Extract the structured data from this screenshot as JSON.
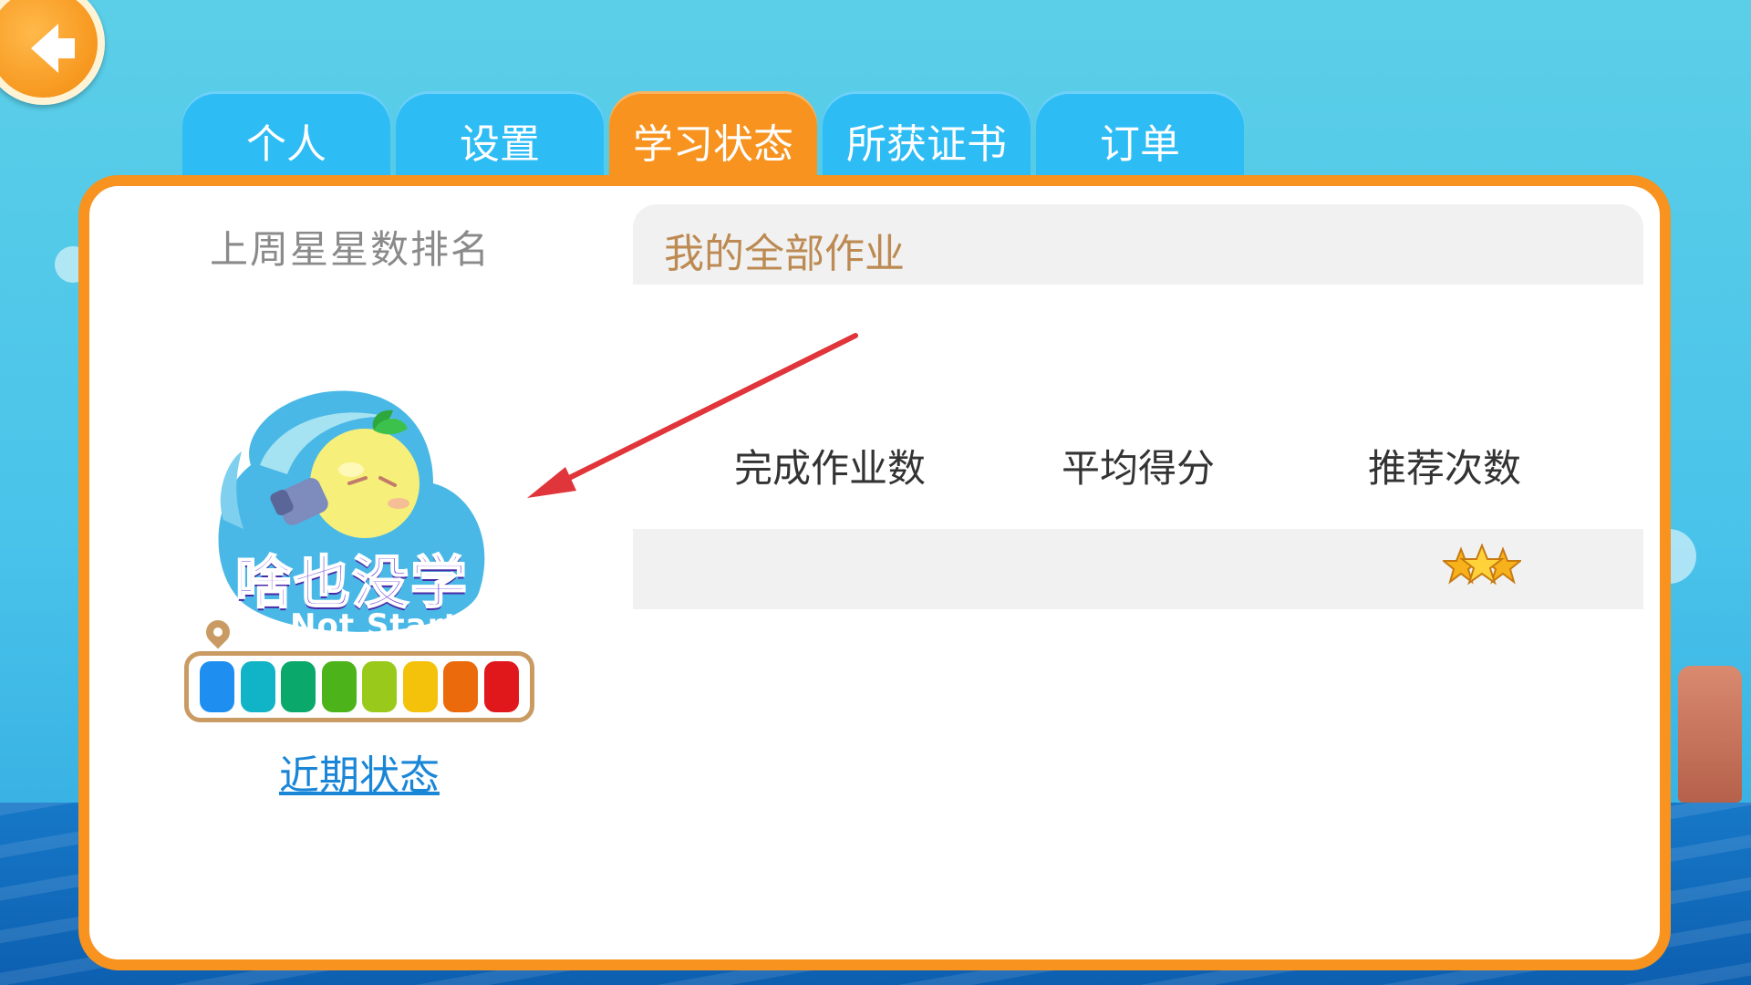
{
  "header": {
    "back_button": "back",
    "tabs": [
      {
        "label": "个人",
        "active": false
      },
      {
        "label": "设置",
        "active": false
      },
      {
        "label": "学习状态",
        "active": true
      },
      {
        "label": "所获证书",
        "active": false
      },
      {
        "label": "订单",
        "active": false
      }
    ]
  },
  "left": {
    "title": "上周星星数排名",
    "status_cn": "啥也没学",
    "status_en": "Not Start Yet",
    "meter_colors": [
      "#1e8ff0",
      "#11b4c6",
      "#0aa86a",
      "#4cb31b",
      "#99c91a",
      "#f4c20b",
      "#ea6a0c",
      "#e0181b"
    ],
    "recent_link": "近期状态"
  },
  "homework": {
    "title": "我的全部作业",
    "columns": [
      "完成作业数",
      "平均得分",
      "推荐次数"
    ],
    "row_icon": "three-stars-icon"
  },
  "colors": {
    "accent": "#f7931e",
    "tab_blue": "#2ebcf5",
    "annotation_arrow": "#e0353a"
  }
}
